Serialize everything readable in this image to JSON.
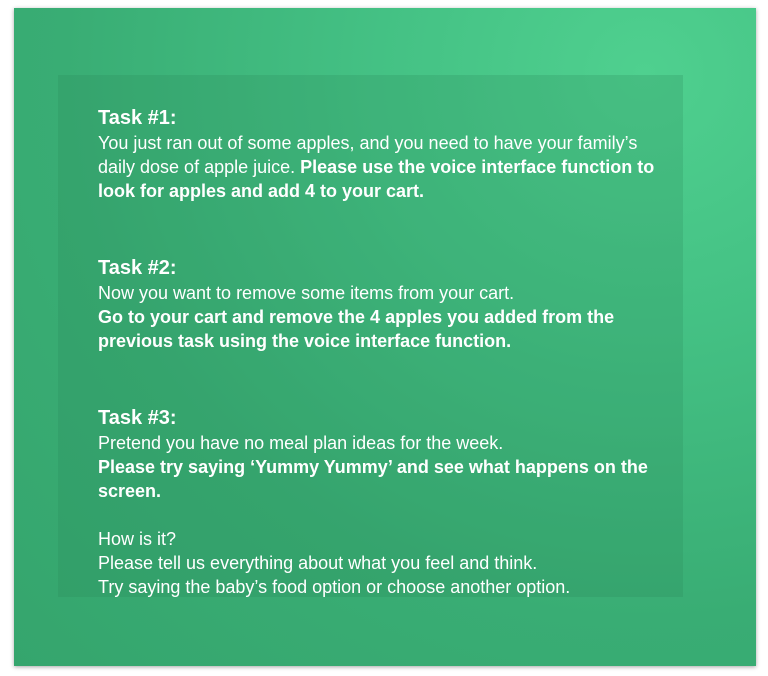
{
  "tasks": [
    {
      "title": "Task #1:",
      "text": "You just ran out of some apples, and you need to have your family’s daily dose of apple juice.",
      "bold": "Please use the voice interface function to look for apples and add 4 to your cart."
    },
    {
      "title": "Task #2:",
      "text": "Now you want to remove some items from your cart.",
      "bold": "Go to your cart and remove the 4 apples you added from the previous task using the voice interface function."
    },
    {
      "title": "Task #3:",
      "text": "Pretend you have no meal plan ideas for the week.",
      "bold": "Please try saying ‘Yummy Yummy’ and see what happens on the screen."
    }
  ],
  "outro": {
    "question": "How is it?",
    "line1": "Please tell us everything about what you feel and think.",
    "line2": "Try saying the baby’s food option or choose another option."
  }
}
